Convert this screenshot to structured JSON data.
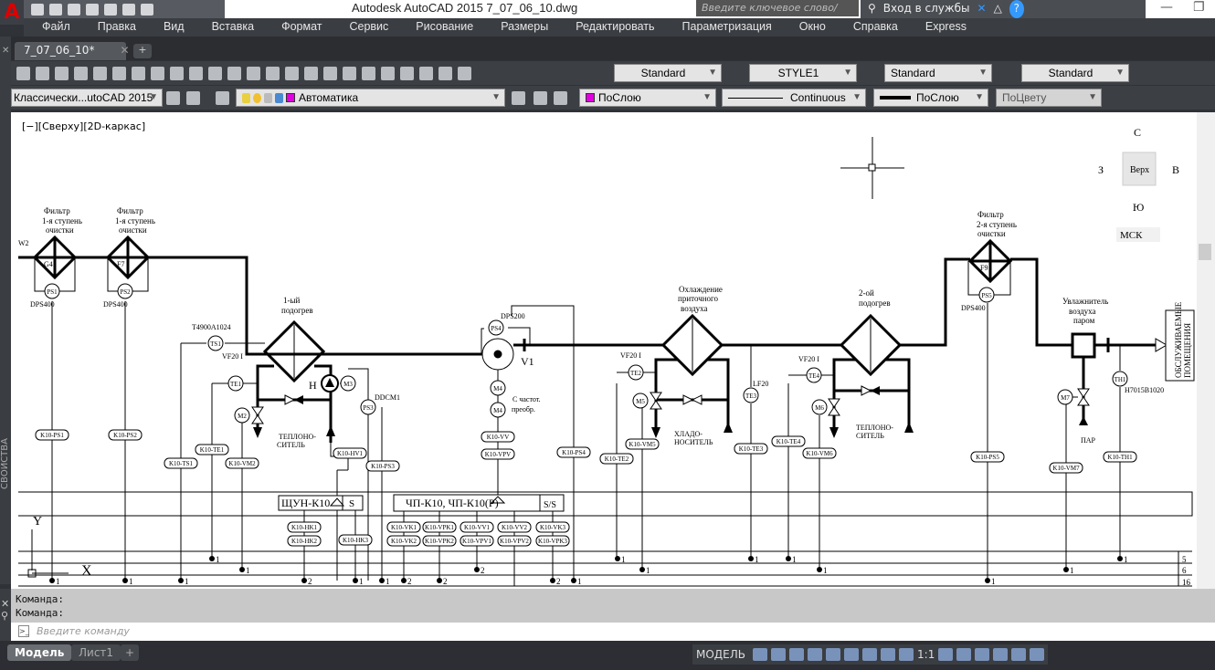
{
  "app": {
    "title": "Autodesk AutoCAD 2015    7_07_06_10.dwg",
    "search_placeholder": "Введите ключевое слово/фразу",
    "signin": "Вход в службы",
    "help": "?"
  },
  "menu": [
    "Файл",
    "Правка",
    "Вид",
    "Вставка",
    "Формат",
    "Сервис",
    "Рисование",
    "Размеры",
    "Редактировать",
    "Параметризация",
    "Окно",
    "Справка",
    "Express"
  ],
  "tabs": {
    "document": "7_07_06_10*",
    "new": "+"
  },
  "toolbar": {
    "text_style": "Standard",
    "dim_style": "STYLE1",
    "table_style": "Standard",
    "mleader_style": "Standard",
    "workspace": "Классически...utoCAD 2015",
    "layer": "Автоматика",
    "color": "ПоСлою",
    "linetype": "Continuous",
    "lineweight": "ПоСлою",
    "plotstyle": "ПоЦвету",
    "accent_color": "#e000e0"
  },
  "viewport": {
    "label": "[−][Сверху][2D-каркас]",
    "viewcube": {
      "north": "С",
      "west": "З",
      "top": "Верх",
      "east": "В",
      "south": "Ю",
      "ucs": "МСК"
    },
    "ucs_x": "X",
    "ucs_y": "Y"
  },
  "diagram": {
    "notes": [
      "Фильтр",
      "1-я ступень",
      "очистки",
      "Фильтр",
      "1-я ступень",
      "очистки",
      "Фильтр",
      "2-я ступень",
      "очистки",
      "1-ый",
      "подогрев",
      "Охлаждение",
      "приточного",
      "воздуха",
      "2-ой",
      "подогрев",
      "Увлажнитель",
      "воздуха",
      "паром",
      "DPS400",
      "DPS400",
      "DPS400",
      "T4900A1024",
      "VF20 I",
      "DDCM1",
      "DPS200",
      "V1",
      "С частот.",
      "преобр.",
      "VF20 I",
      "LF20",
      "VF20 I",
      "ТЕПЛОНО-",
      "СИТЕЛЬ",
      "ХЛАДО-",
      "НОСИТЕЛЬ",
      "ТЕПЛОНО-",
      "СИТЕЛЬ",
      "ПАР",
      "H7015B1020",
      "Н",
      "G4",
      "F7",
      "F9",
      "W2"
    ],
    "instruments": [
      "PS1",
      "PS2",
      "TS1",
      "TE1",
      "M2",
      "M3",
      "PS3",
      "PS4",
      "M4",
      "M4",
      "TE2",
      "M5",
      "TE3",
      "TE4",
      "M6",
      "PS5",
      "M7",
      "TH1"
    ],
    "tags": [
      "K10-PS1",
      "K10-PS2",
      "K10-TS1",
      "K10-TE1",
      "K10-VM2",
      "K10-HV1",
      "K10-PS3",
      "K10-VV",
      "K10-VPV",
      "K10-PS4",
      "K10-TE2",
      "K10-VM5",
      "K10-TE3",
      "K10-TE4",
      "K10-VM6",
      "K10-PS5",
      "K10-VM7",
      "K10-TH1",
      "K10-HK1",
      "K10-HK2",
      "K10-HK3",
      "K10-VK1",
      "K10-VK2",
      "K10-VPK1",
      "K10-VPK2",
      "K10-VV1",
      "K10-VPV1",
      "K10-VV2",
      "K10-VPV2",
      "K10-VK3",
      "K10-VPK3"
    ],
    "outlet": [
      "ОБСЛУЖИВАЕМЫЕ",
      "ПОМЕЩЕНИЯ"
    ],
    "panels": {
      "shun": "ЩУН-К10",
      "shun_s": "S",
      "chp": "ЧП-К10, ЧП-К10(Р)",
      "chp_s": "S/S"
    },
    "dot_labels": [
      "1",
      "1",
      "1",
      "1",
      "1",
      "1",
      "2",
      "1",
      "1",
      "1",
      "1",
      "1",
      "1",
      "2",
      "1",
      "1",
      "2",
      "2",
      "2",
      "1",
      "1"
    ],
    "row_numbers": [
      "5",
      "6",
      "16"
    ]
  },
  "command": {
    "history": [
      "Команда:",
      "Команда:"
    ],
    "placeholder": "Введите команду"
  },
  "layout_tabs": [
    "Модель",
    "Лист1",
    "+"
  ],
  "status": {
    "model": "МОДЕЛЬ",
    "scale": "1:1"
  }
}
